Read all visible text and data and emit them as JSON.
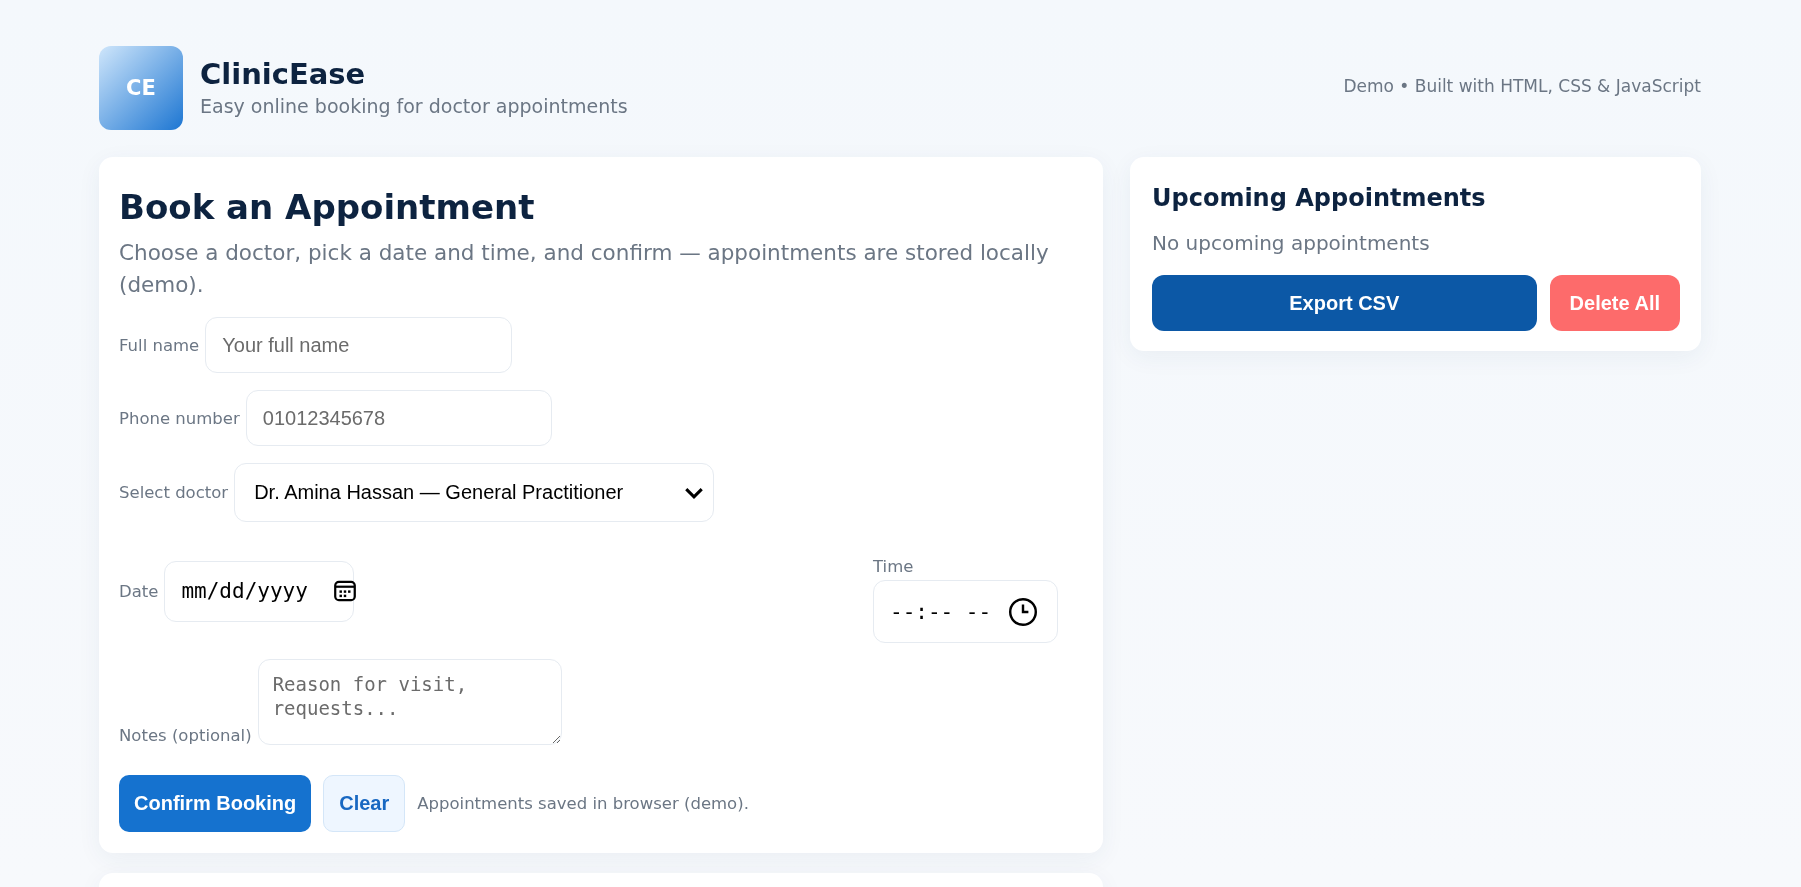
{
  "brand": {
    "logo": "CE",
    "name": "ClinicEase",
    "tagline": "Easy online booking for doctor appointments"
  },
  "header_note": "Demo • Built with HTML, CSS & JavaScript",
  "booking": {
    "title": "Book an Appointment",
    "description": "Choose a doctor, pick a date and time, and confirm — appointments are stored locally (demo).",
    "fields": [
      {
        "kind": "text",
        "label": "Full name",
        "placeholder": "Your full name"
      },
      {
        "kind": "text",
        "label": "Phone number",
        "placeholder": "01012345678"
      },
      {
        "kind": "select",
        "label": "Select doctor",
        "value": "Dr. Amina Hassan — General Practitioner"
      },
      {
        "kind": "date",
        "label": "Date",
        "placeholder": "mm/dd/yyyy"
      },
      {
        "kind": "time",
        "label": "Time",
        "placeholder": "--:-- --"
      },
      {
        "kind": "textarea",
        "label": "Notes (optional)",
        "placeholder": "Reason for visit, requests..."
      }
    ],
    "buttons": [
      {
        "kind": "primary",
        "label": "Confirm Booking"
      },
      {
        "kind": "secondary",
        "label": "Clear"
      }
    ],
    "note": "Appointments saved in browser (demo)."
  },
  "upcoming": {
    "title": "Upcoming Appointments",
    "empty_text": "No upcoming appointments",
    "buttons": [
      {
        "kind": "primary",
        "label": "Export CSV"
      },
      {
        "kind": "danger",
        "label": "Delete All"
      }
    ]
  }
}
